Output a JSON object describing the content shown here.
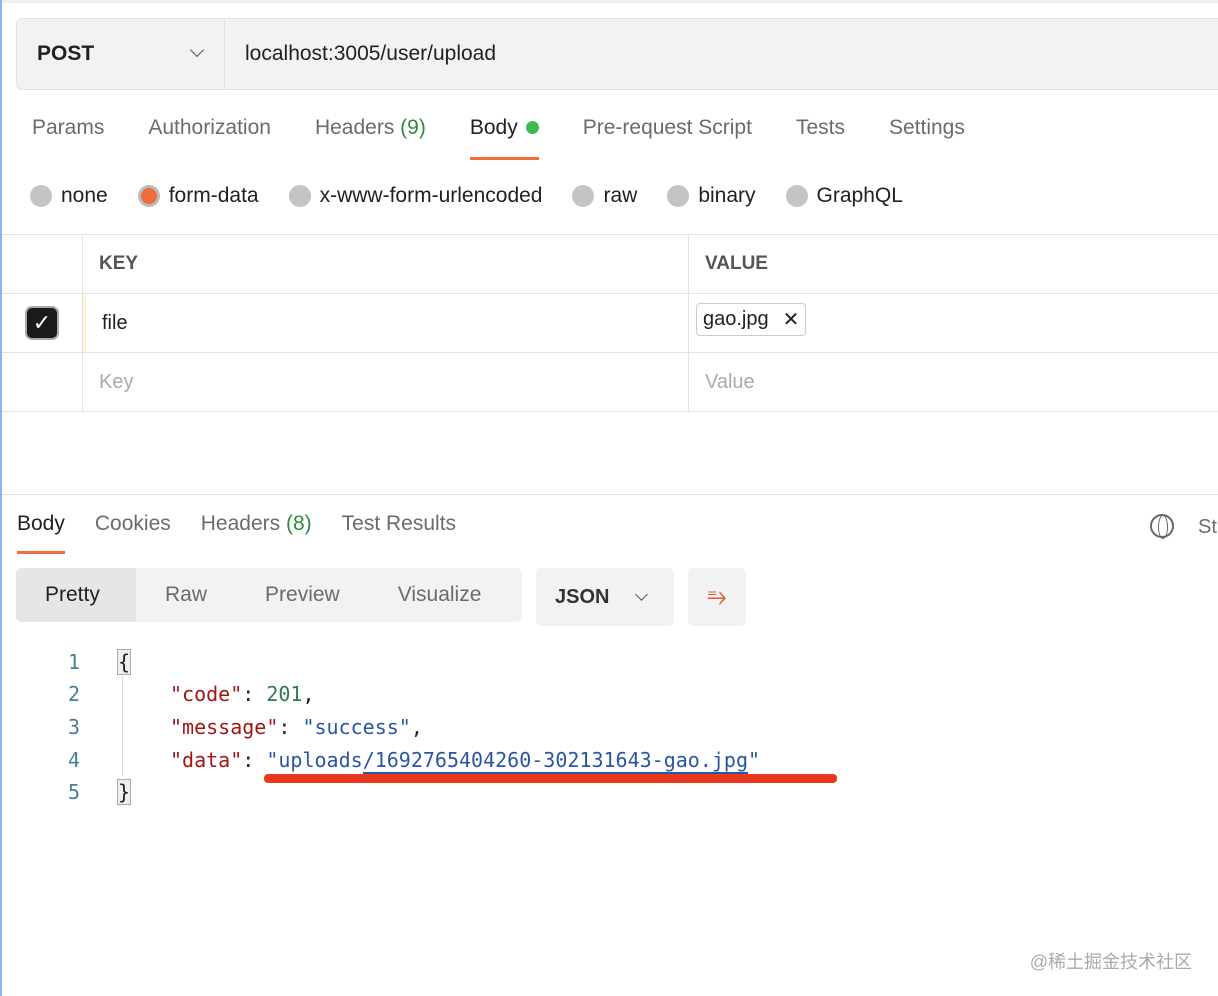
{
  "request": {
    "method": "POST",
    "url": "localhost:3005/user/upload"
  },
  "tabs": [
    {
      "label": "Params"
    },
    {
      "label": "Authorization"
    },
    {
      "label": "Headers",
      "count": "(9)"
    },
    {
      "label": "Body"
    },
    {
      "label": "Pre-request Script"
    },
    {
      "label": "Tests"
    },
    {
      "label": "Settings"
    }
  ],
  "body_types": [
    "none",
    "form-data",
    "x-www-form-urlencoded",
    "raw",
    "binary",
    "GraphQL"
  ],
  "selected_body_type": "form-data",
  "table": {
    "key_header": "KEY",
    "value_header": "VALUE",
    "rows": [
      {
        "key": "file",
        "value": "gao.jpg",
        "checked": true
      }
    ],
    "key_placeholder": "Key",
    "value_placeholder": "Value"
  },
  "response_tabs": [
    {
      "label": "Body"
    },
    {
      "label": "Cookies"
    },
    {
      "label": "Headers",
      "count": "(8)"
    },
    {
      "label": "Test Results"
    }
  ],
  "status_partial": "St",
  "view_modes": [
    "Pretty",
    "Raw",
    "Preview",
    "Visualize"
  ],
  "format": "JSON",
  "code": {
    "lines": [
      "1",
      "2",
      "3",
      "4",
      "5"
    ],
    "open": "{",
    "close": "}",
    "k_code": "\"code\"",
    "v_code": "201",
    "k_message": "\"message\"",
    "v_message": "\"success\"",
    "k_data": "\"data\"",
    "v_data_q1": "\"",
    "v_data_a": "uploads",
    "v_data_b": "/1692765404260-302131643-gao.jpg",
    "v_data_q2": "\""
  },
  "watermark": "@稀土掘金技术社区"
}
